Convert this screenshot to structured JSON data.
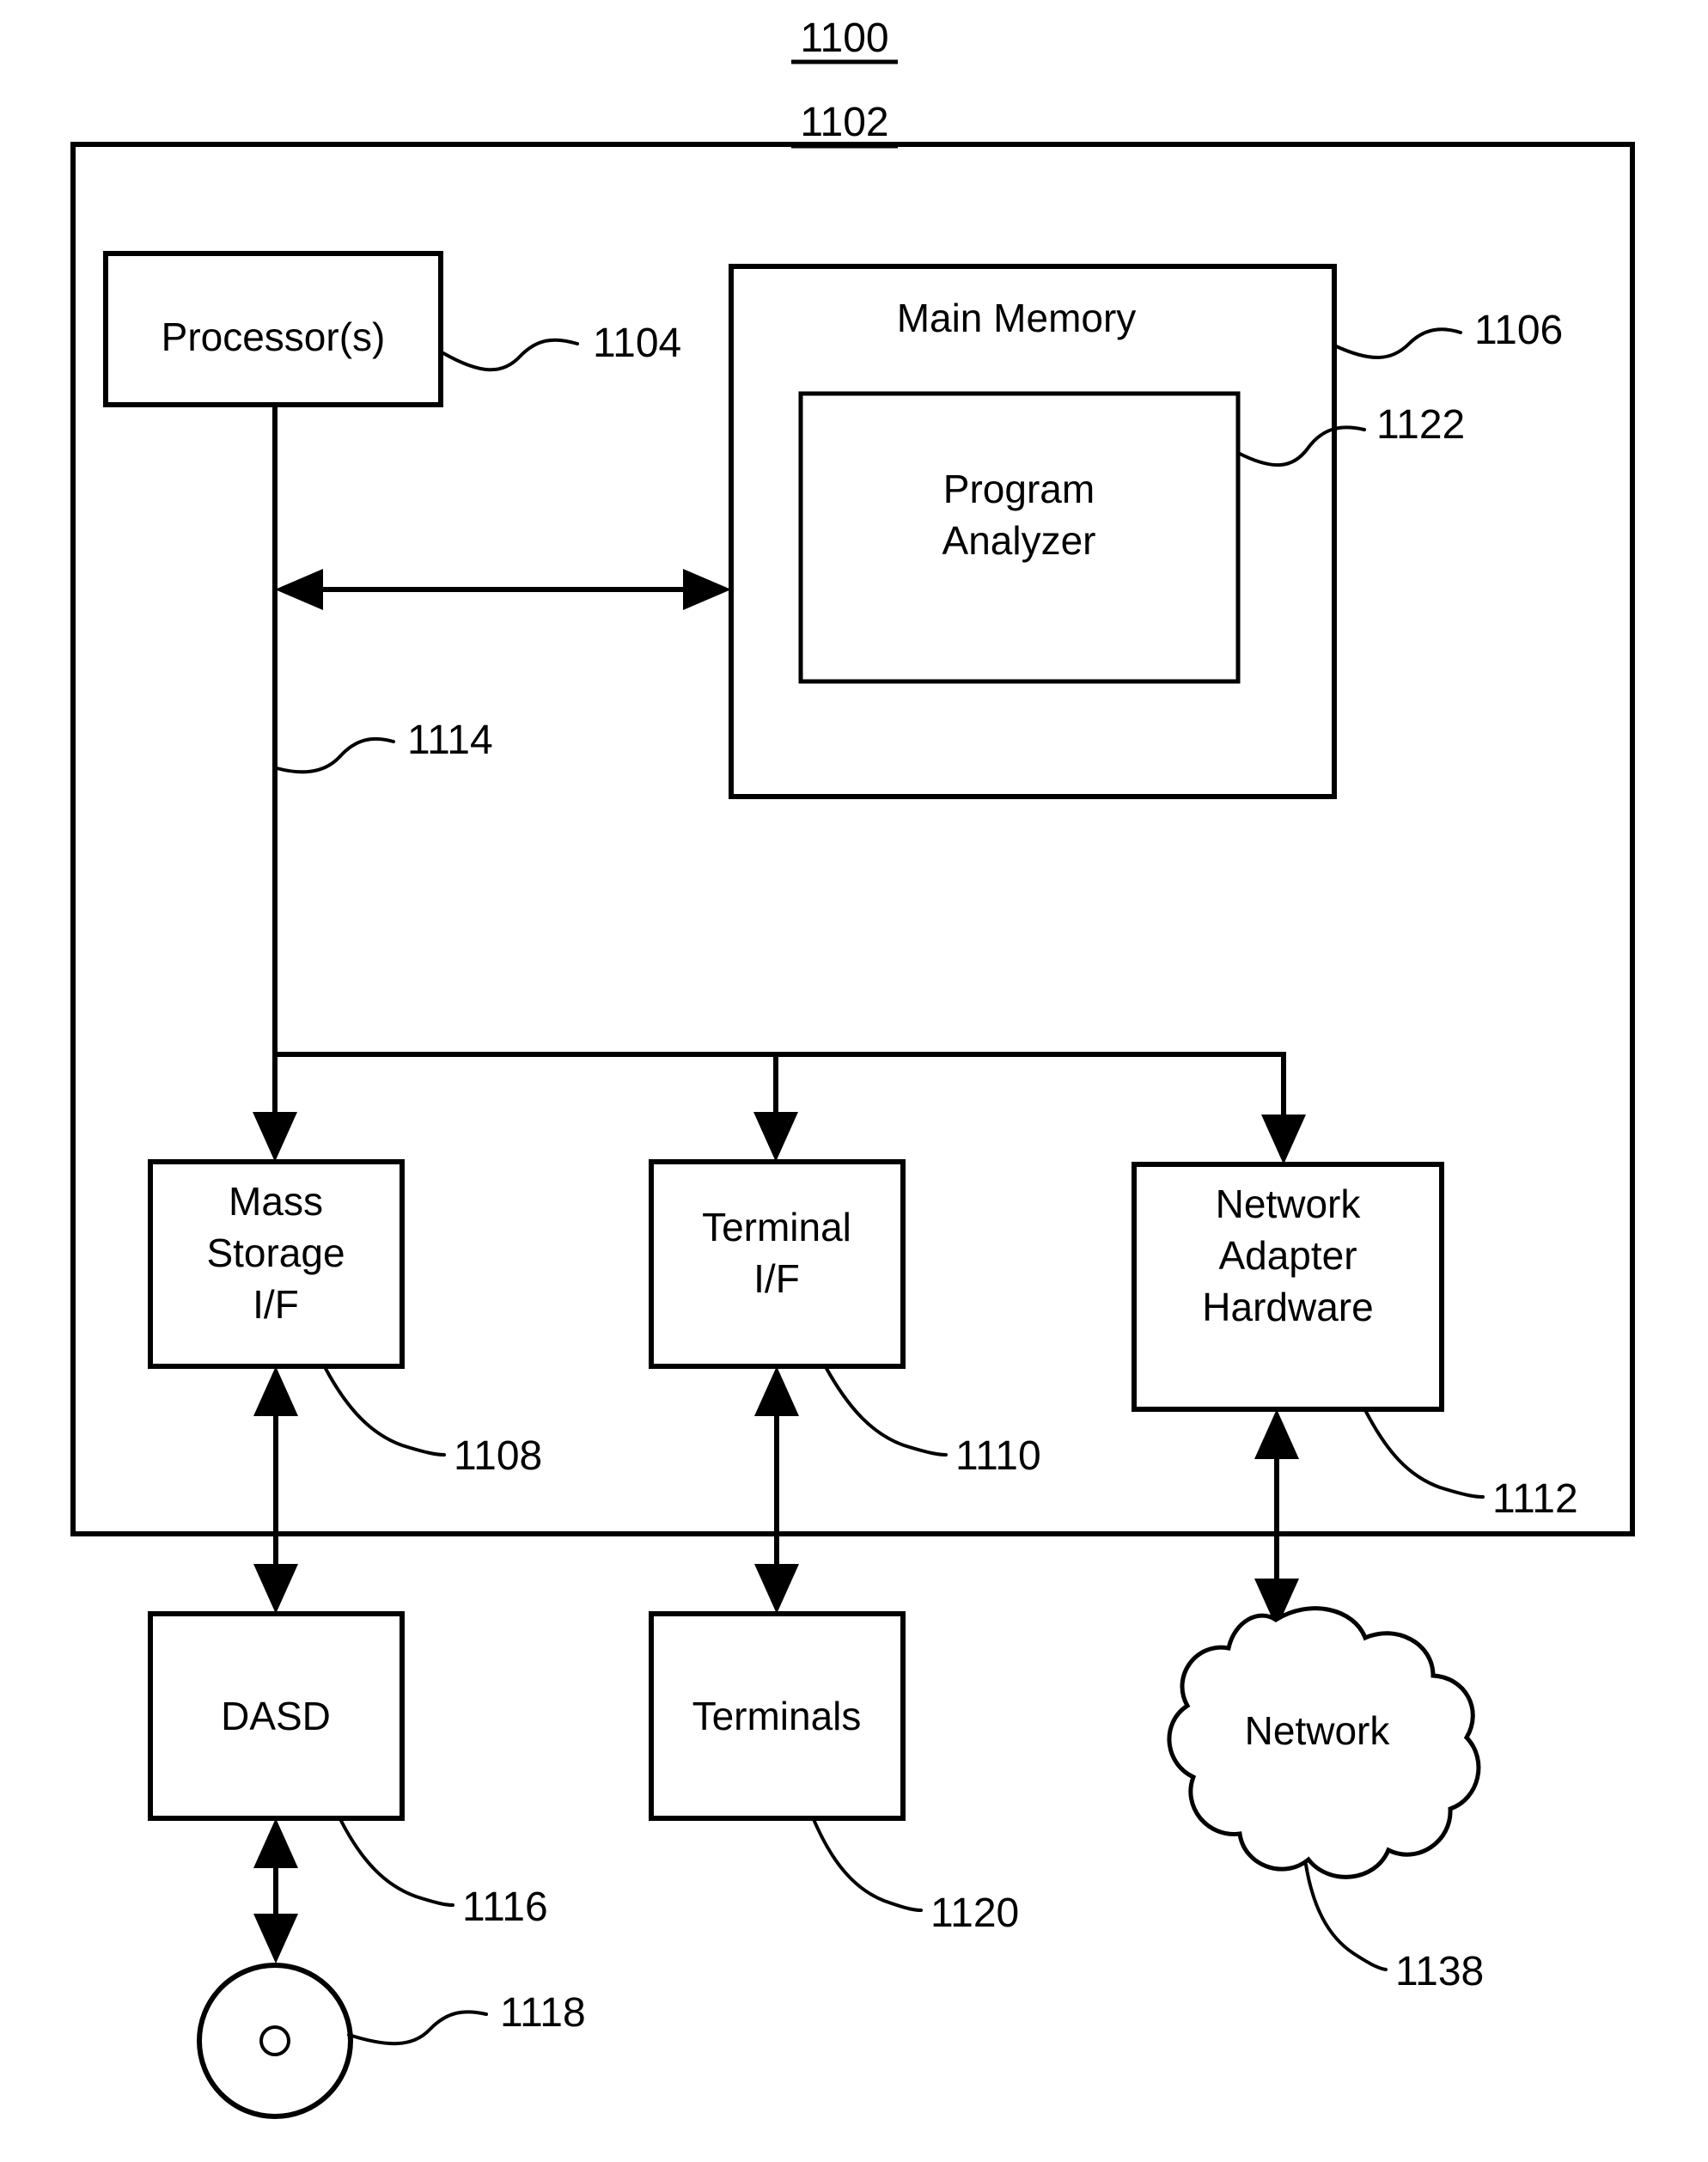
{
  "figure": {
    "system_number": "1100",
    "computer_system_number": "1102"
  },
  "blocks": {
    "processor": {
      "label": "Processor(s)",
      "ref": "1104"
    },
    "main_memory": {
      "label": "Main Memory",
      "ref": "1106"
    },
    "program_analyzer": {
      "label_line1": "Program",
      "label_line2": "Analyzer",
      "ref": "1122"
    },
    "bus": {
      "ref": "1114"
    },
    "mass_storage_if": {
      "label_line1": "Mass",
      "label_line2": "Storage",
      "label_line3": "I/F",
      "ref": "1108"
    },
    "terminal_if": {
      "label_line1": "Terminal",
      "label_line2": "I/F",
      "ref": "1110"
    },
    "network_adapter": {
      "label_line1": "Network",
      "label_line2": "Adapter",
      "label_line3": "Hardware",
      "ref": "1112"
    },
    "dasd": {
      "label": "DASD",
      "ref": "1116"
    },
    "disk": {
      "ref": "1118"
    },
    "terminals": {
      "label": "Terminals",
      "ref": "1120"
    },
    "network": {
      "label": "Network",
      "ref": "1138"
    }
  },
  "colors": {
    "stroke": "#000000",
    "background": "#ffffff"
  }
}
